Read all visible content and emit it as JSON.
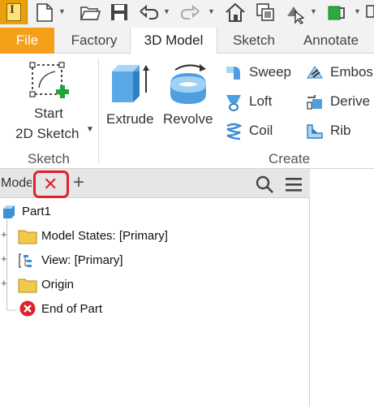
{
  "app": {
    "logo_letter": "I"
  },
  "quick_access": {
    "icons": [
      "new-file-icon",
      "open-folder-icon",
      "save-icon",
      "undo-icon",
      "redo-icon",
      "home-icon",
      "update-icon",
      "select-icon",
      "appearance-icon",
      "settings-icon"
    ]
  },
  "tabs": [
    {
      "label": "File",
      "active": false
    },
    {
      "label": "Factory",
      "active": false
    },
    {
      "label": "3D Model",
      "active": true
    },
    {
      "label": "Sketch",
      "active": false
    },
    {
      "label": "Annotate",
      "active": false
    }
  ],
  "ribbon": {
    "sketch_group": {
      "start_sketch_line1": "Start",
      "start_sketch_line2": "2D Sketch",
      "title": "Sketch"
    },
    "create_group": {
      "extrude": "Extrude",
      "revolve": "Revolve",
      "sweep": "Sweep",
      "loft": "Loft",
      "coil": "Coil",
      "emboss": "Embos",
      "derive": "Derive",
      "rib": "Rib",
      "title": "Create"
    }
  },
  "browser": {
    "title": "Mode",
    "close_symbol": "✕",
    "add_symbol": "+",
    "tree": {
      "root": "Part1",
      "model_states": "Model States: [Primary]",
      "view": "View: [Primary]",
      "origin": "Origin",
      "end_of_part": "End of Part"
    }
  },
  "colors": {
    "file_tab": "#f6a01a",
    "close_highlight": "#e0202c",
    "folder_yellow": "#f3c94c",
    "part_blue": "#3d8fd6"
  }
}
